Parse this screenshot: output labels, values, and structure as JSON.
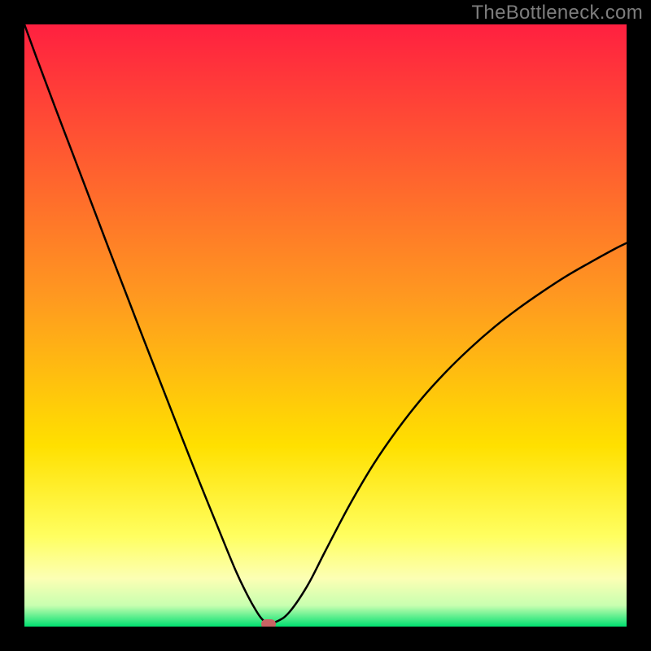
{
  "watermark": "TheBottleneck.com",
  "chart_data": {
    "type": "line",
    "title": "",
    "xlabel": "",
    "ylabel": "",
    "xlim": [
      0,
      100
    ],
    "ylim": [
      0,
      100
    ],
    "background_gradient_stops": [
      {
        "offset": 0.0,
        "color": "#ff2040"
      },
      {
        "offset": 0.45,
        "color": "#ff9820"
      },
      {
        "offset": 0.7,
        "color": "#ffe000"
      },
      {
        "offset": 0.85,
        "color": "#ffff60"
      },
      {
        "offset": 0.92,
        "color": "#fcffb4"
      },
      {
        "offset": 0.965,
        "color": "#c8ffb0"
      },
      {
        "offset": 1.0,
        "color": "#00e070"
      }
    ],
    "series": [
      {
        "name": "bottleneck-curve",
        "x": [
          0,
          2,
          5,
          8,
          11,
          14,
          17,
          20,
          23,
          26,
          29,
          32,
          35,
          37,
          38.5,
          39.5,
          40.5,
          42,
          44,
          47,
          50,
          54,
          58,
          62,
          66,
          70,
          74,
          78,
          82,
          86,
          90,
          94,
          98,
          100
        ],
        "values": [
          100,
          94.5,
          86.5,
          78.6,
          70.7,
          62.8,
          55.0,
          47.2,
          39.5,
          31.8,
          24.2,
          16.8,
          9.5,
          5.3,
          2.6,
          1.2,
          0.6,
          0.9,
          2.4,
          6.8,
          12.6,
          20.2,
          27.0,
          32.8,
          37.9,
          42.3,
          46.2,
          49.7,
          52.8,
          55.6,
          58.2,
          60.5,
          62.7,
          63.7
        ]
      }
    ],
    "minimum_marker": {
      "x": 40.5,
      "y": 0.4
    }
  }
}
